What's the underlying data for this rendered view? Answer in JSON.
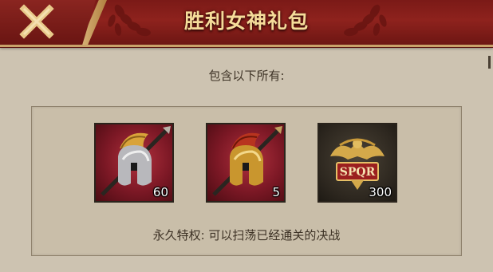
{
  "header": {
    "title": "胜利女神礼包",
    "close_icon": "close-x-icon"
  },
  "content": {
    "subtitle": "包含以下所有:",
    "items": [
      {
        "icon": "silver-spartan-helmet-icon",
        "count": "60"
      },
      {
        "icon": "gold-spartan-helmet-icon",
        "count": "5"
      },
      {
        "icon": "spqr-eagle-emblem-icon",
        "count": "300"
      }
    ],
    "footnote": "永久特权: 可以扫荡已经通关的决战"
  },
  "colors": {
    "header_red": "#8e221d",
    "title_gold": "#f5dc9a",
    "panel_bg": "#c9bea9",
    "page_bg": "#cdc3b1"
  }
}
